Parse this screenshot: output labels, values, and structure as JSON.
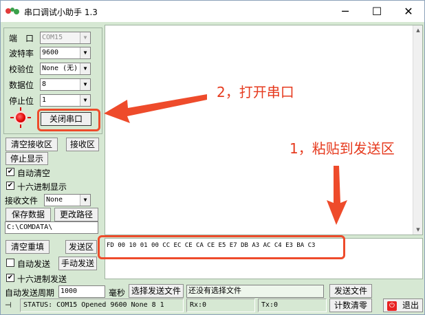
{
  "window": {
    "title": "串口调试小助手 1.3",
    "minimize_glyph": "─",
    "maximize_glyph": "☐",
    "close_glyph": "✕"
  },
  "port_settings": {
    "port_label": "端　口",
    "port_value": "COM15",
    "baud_label": "波特率",
    "baud_value": "9600",
    "parity_label": "校验位",
    "parity_value": "None (无)",
    "databits_label": "数据位",
    "databits_value": "8",
    "stopbits_label": "停止位",
    "stopbits_value": "1",
    "open_close_label": "关闭串口"
  },
  "receive_controls": {
    "clear_label": "清空接收区",
    "area_label": "接收区",
    "stop_display_label": "停止显示",
    "auto_clear_label": "自动清空",
    "auto_clear_checked": "✔",
    "hex_display_label": "十六进制显示",
    "hex_display_checked": "✔",
    "file_label": "接收文件",
    "file_value": "None",
    "save_data_label": "保存数据",
    "change_path_label": "更改路径",
    "path_value": "C:\\COMDATA\\"
  },
  "send_controls": {
    "clear_resend_label": "清空重填",
    "area_label": "发送区",
    "auto_send_label": "自动发送",
    "manual_send_label": "手动发送",
    "hex_send_label": "十六进制发送",
    "hex_send_checked": "✔",
    "period_label": "自动发送周期",
    "period_value": "1000",
    "period_unit": "毫秒",
    "select_file_label": "选择发送文件",
    "no_file_text": "还没有选择文件",
    "send_file_label": "发送文件",
    "send_content": "FD 00 10 01 00 CC EC CE CA CE E5 E7 DB A3 AC C4 E3 BA C3"
  },
  "status_bar": {
    "status_text": "STATUS: COM15 Opened 9600 None  8 1",
    "rx_text": "Rx:0",
    "tx_text": "Tx:0",
    "count_clear_label": "计数清零",
    "exit_label": "退出",
    "exit_icon_glyph": "⏻",
    "pin_icon_glyph": "⊣"
  },
  "annotations": {
    "step2_text": "2，打开串口",
    "step1_text": "1，粘贴到发送区",
    "color": "#ee4b2b"
  }
}
